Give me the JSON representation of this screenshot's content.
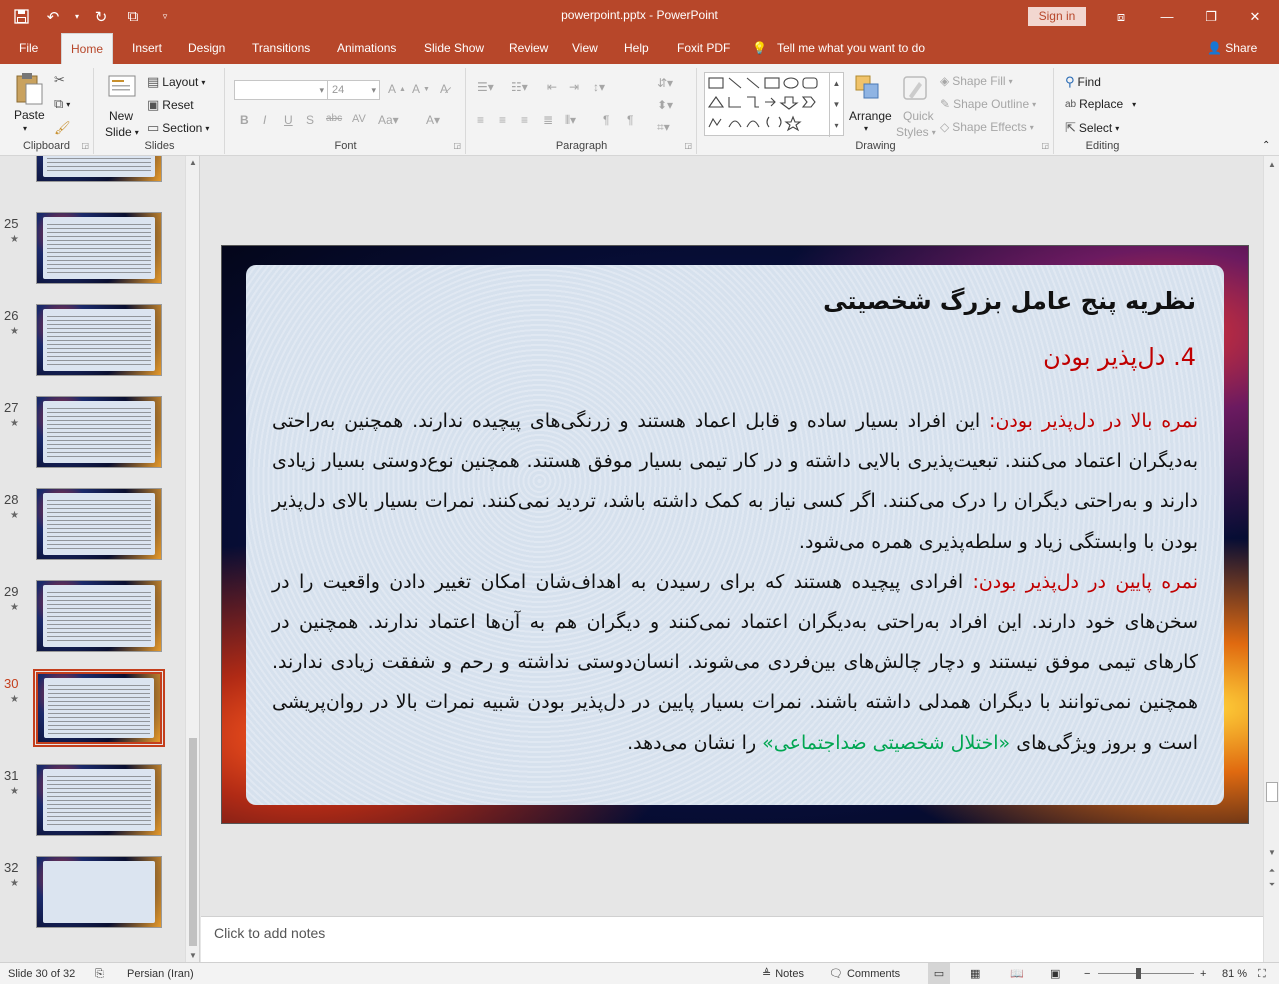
{
  "window": {
    "title": "powerpoint.pptx  -  PowerPoint",
    "signin": "Sign in"
  },
  "tabs": [
    "File",
    "Home",
    "Insert",
    "Design",
    "Transitions",
    "Animations",
    "Slide Show",
    "Review",
    "View",
    "Help",
    "Foxit PDF"
  ],
  "tellme": "Tell me what you want to do",
  "share": "Share",
  "ribbon": {
    "clipboard": {
      "label": "Clipboard",
      "paste": "Paste"
    },
    "slides": {
      "label": "Slides",
      "new_slide_1": "New",
      "new_slide_2": "Slide",
      "layout": "Layout",
      "reset": "Reset",
      "section": "Section"
    },
    "font": {
      "label": "Font",
      "size": "24"
    },
    "paragraph": {
      "label": "Paragraph"
    },
    "drawing": {
      "label": "Drawing",
      "arrange": "Arrange",
      "quick_styles_1": "Quick",
      "quick_styles_2": "Styles",
      "shape_fill": "Shape Fill",
      "shape_outline": "Shape Outline",
      "shape_effects": "Shape Effects"
    },
    "editing": {
      "label": "Editing",
      "find": "Find",
      "replace": "Replace",
      "select": "Select"
    }
  },
  "thumbnails": [
    {
      "num": "25"
    },
    {
      "num": "26"
    },
    {
      "num": "27"
    },
    {
      "num": "28"
    },
    {
      "num": "29"
    },
    {
      "num": "30"
    },
    {
      "num": "31"
    },
    {
      "num": "32"
    }
  ],
  "slide": {
    "title": "نظریه پنج عامل بزرگ شخصیتی",
    "subtitle": "4. دل‌پذیر بودن",
    "p1_lead": "نمره بالا در دل‌پذیر بودن:",
    "p1_text": " این افراد بسیار ساده و قابل اعماد هستند و زرنگی‌های پیچیده ندارند. همچنین به‌راحتی به‌دیگران اعتماد می‌کنند. تبعیت‌پذیری بالایی داشته و در کار تیمی بسیار موفق هستند. همچنین نوع‌دوستی بسیار زیادی دارند و به‌راحتی دیگران را درک می‌کنند. اگر کسی نیاز به کمک داشته باشد، تردید نمی‌کنند. نمرات بسیار بالای دل‌پذیر بودن با وابستگی زیاد و سلطه‌پذیری همره می‌شود.",
    "p2_lead": "نمره پایین در دل‌پذیر بودن:",
    "p2_text": " افرادی پیچیده هستند که برای رسیدن به اهداف‌شان امکان تغییر دادن واقعیت را در سخن‌های خود دارند. این افراد به‌راحتی به‌دیگران اعتماد نمی‌کنند و دیگران هم به آن‌ها اعتماد ندارند. همچنین در کارهای تیمی موفق نیستند و دچار چالش‌های بین‌فردی می‌شوند. انسان‌دوستی نداشته و رحم و شفقت زیادی ندارند. همچنین نمی‌توانند با دیگران همدلی داشته باشند. نمرات بسیار پایین در دل‌پذیر بودن شبیه نمرات بالا در روان‌پریشی است و بروز ویژگی‌های ",
    "p2_green": "«اختلال شخصیتی ضداجتماعی»",
    "p2_end": " را نشان می‌دهد."
  },
  "notes_placeholder": "Click to add notes",
  "status": {
    "slide_counter": "Slide 30 of 32",
    "language": "Persian (Iran)",
    "notes": "Notes",
    "comments": "Comments",
    "zoom": "81 %"
  },
  "colors": {
    "accent": "#b7472a",
    "selected_thumb": "#c43e1c",
    "slide_red": "#c00000",
    "slide_green": "#00a651"
  }
}
